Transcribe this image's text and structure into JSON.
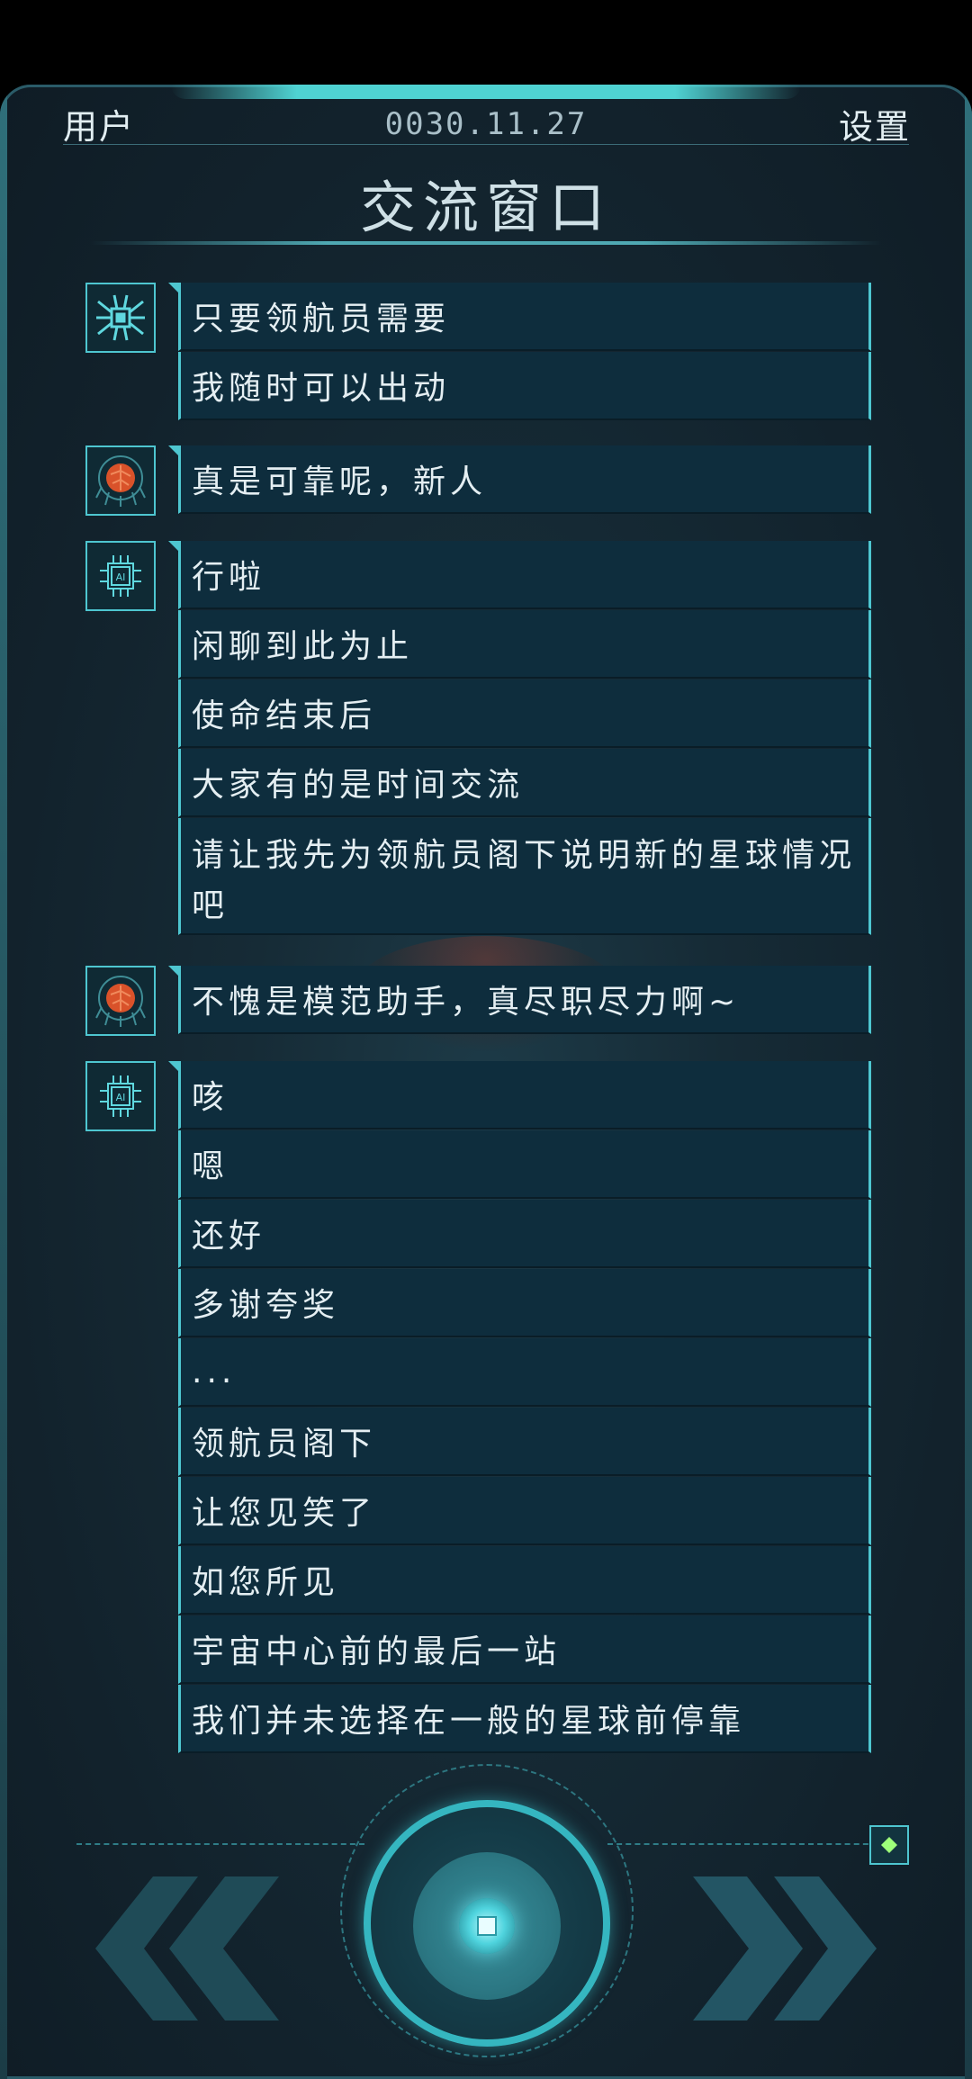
{
  "header": {
    "user_label": "用户",
    "date": "0030.11.27",
    "settings_label": "设置"
  },
  "title": "交流窗口",
  "messages": [
    {
      "avatar": "robot-spider-icon",
      "lines": [
        "只要领航员需要",
        "我随时可以出动"
      ]
    },
    {
      "avatar": "orange-brain-icon",
      "lines": [
        "真是可靠呢，新人"
      ]
    },
    {
      "avatar": "ai-chip-icon",
      "lines": [
        "行啦",
        "闲聊到此为止",
        "使命结束后",
        "大家有的是时间交流",
        "请让我先为领航员阁下说明新的星球情况吧"
      ]
    },
    {
      "avatar": "orange-brain-icon",
      "lines": [
        "不愧是模范助手，真尽职尽力啊~"
      ]
    },
    {
      "avatar": "ai-chip-icon",
      "lines": [
        "咳",
        "嗯",
        "还好",
        "多谢夸奖",
        "...",
        "领航员阁下",
        "让您见笑了",
        "如您所见",
        "宇宙中心前的最后一站",
        "我们并未选择在一般的星球前停靠"
      ]
    }
  ],
  "controls": {
    "rewind_icon": "double-chevron-left-icon",
    "play_icon": "circle-play-icon",
    "forward_icon": "double-chevron-right-icon",
    "auto_icon": "diamond-icon"
  },
  "colors": {
    "accent": "#4ec6d0",
    "bubble_bg": "#0e2d3d",
    "avatar_orange": "#d9522a"
  }
}
